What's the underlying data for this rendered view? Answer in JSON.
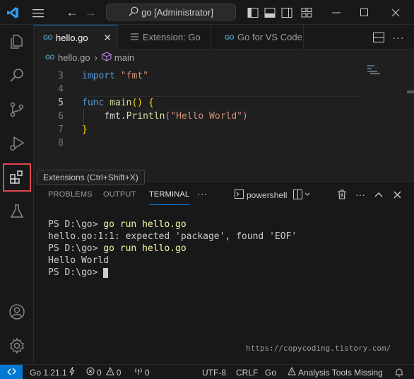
{
  "titlebar": {
    "search_text": "go [Administrator]"
  },
  "activity": {
    "tooltip": "Extensions (Ctrl+Shift+X)"
  },
  "tabs": [
    {
      "label": "hello.go",
      "icon": "go-file-icon",
      "active": true
    },
    {
      "label": "Extension: Go",
      "icon": "extension-page-icon",
      "active": false
    },
    {
      "label": "Go for VS Code",
      "icon": "go-file-icon",
      "active": false
    }
  ],
  "breadcrumb": {
    "file": "hello.go",
    "symbol": "main"
  },
  "editor": {
    "lines": [
      {
        "n": "3",
        "text": "import \"fmt\""
      },
      {
        "n": "4",
        "text": ""
      },
      {
        "n": "5",
        "text": "func main() {"
      },
      {
        "n": "6",
        "text": "    fmt.Println(\"Hello World\")"
      },
      {
        "n": "7",
        "text": "}"
      },
      {
        "n": "8",
        "text": ""
      }
    ],
    "tok": {
      "import": "import",
      "fmt_str": "\"fmt\"",
      "func": "func",
      "main": "main",
      "parens": "()",
      "open_brace": "{",
      "fmt_pkg": "fmt.",
      "println": "Println",
      "open_paren": "(",
      "hello_str": "\"Hello World\"",
      "close_paren": ")",
      "close_brace": "}"
    }
  },
  "panel": {
    "tabs": [
      "PROBLEMS",
      "OUTPUT",
      "TERMINAL"
    ],
    "active_tab": "TERMINAL",
    "more": "···",
    "shell": "powershell",
    "terminal": {
      "prompt": "PS D:\\go>",
      "cmd": "go run hello.go",
      "error": "hello.go:1:1: expected 'package', found 'EOF'",
      "output": "Hello World"
    },
    "watermark": "https://copycoding.tistory.com/"
  },
  "status": {
    "go_version": "Go 1.21.1",
    "errors": "0",
    "warnings": "0",
    "ports": "0",
    "encoding": "UTF-8",
    "eol": "CRLF",
    "language": "Go",
    "analysis": "Analysis Tools Missing"
  },
  "colors": {
    "accent": "#0078d4",
    "highlight_box": "#e0454f",
    "keyword": "#569cd6",
    "string": "#ce9178",
    "function": "#dcdcaa"
  }
}
